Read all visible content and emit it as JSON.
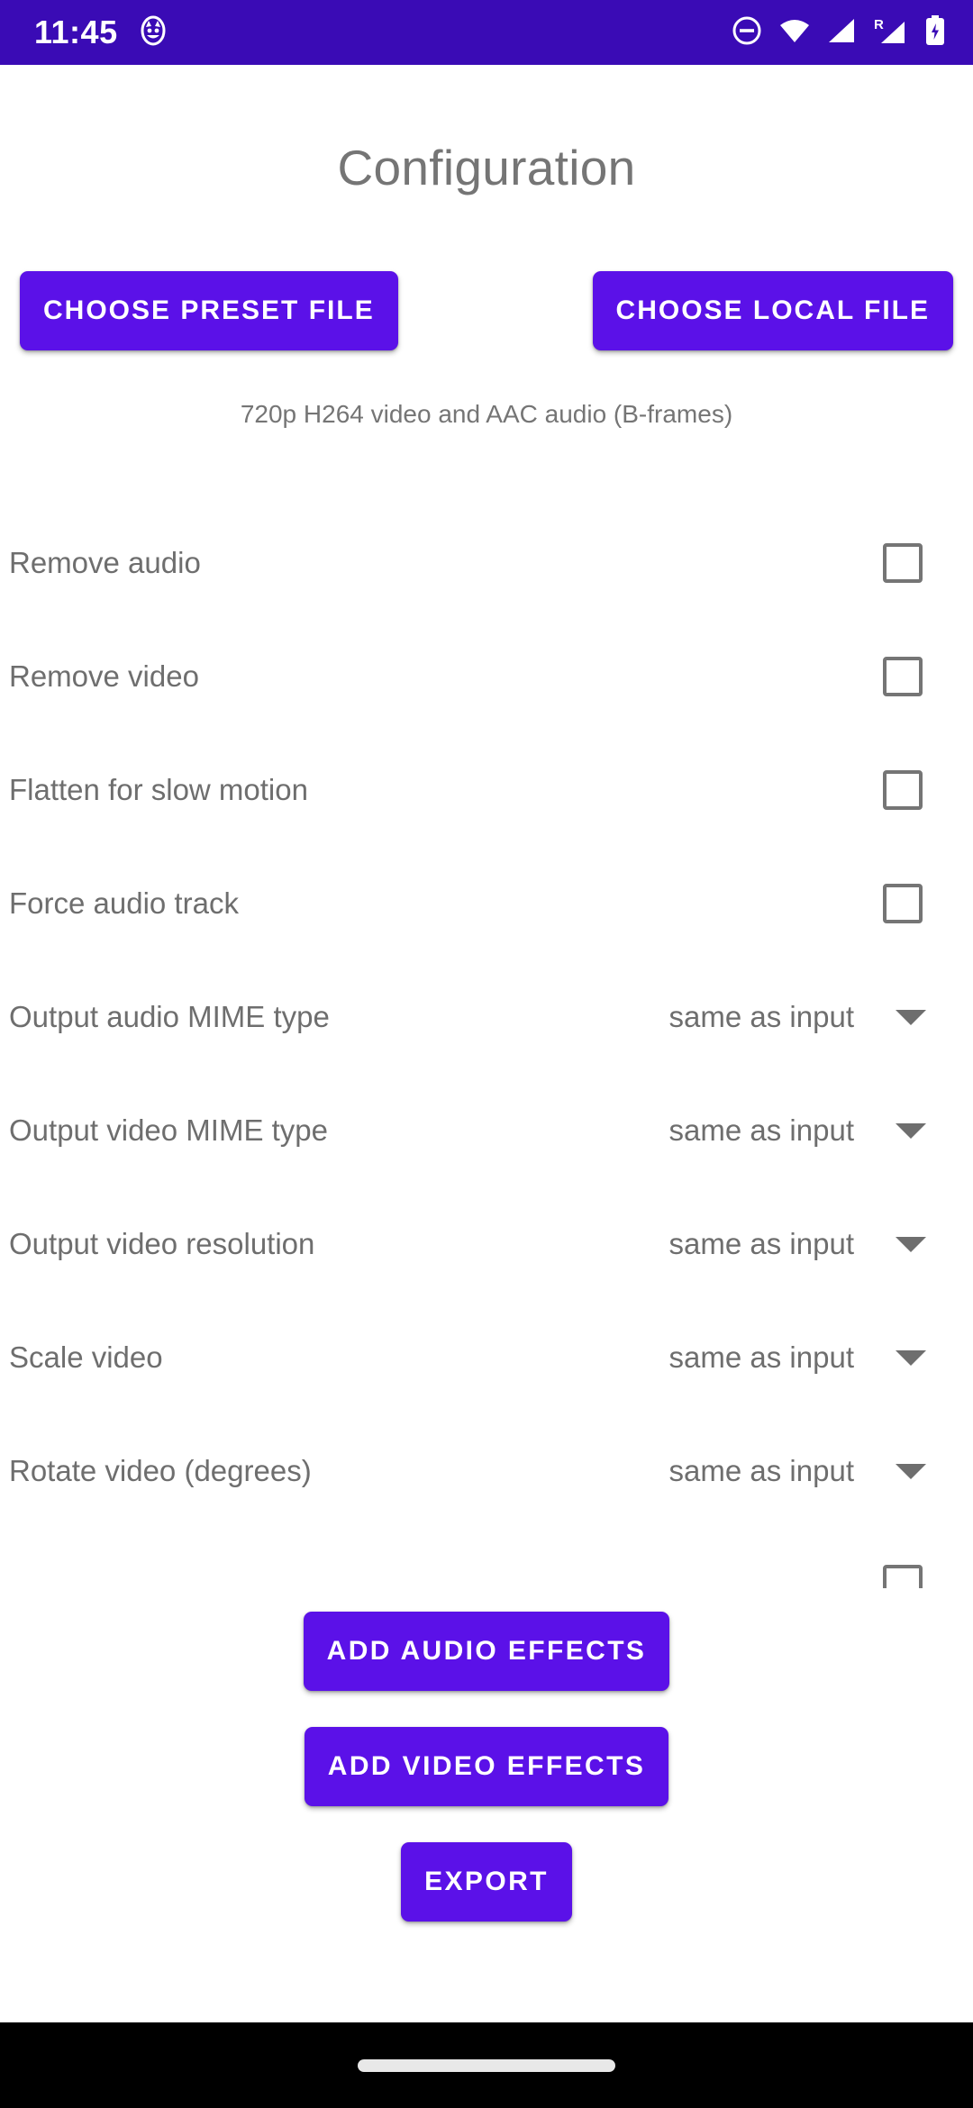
{
  "status_bar": {
    "time": "11:45",
    "background_color": "#3A0BB5",
    "icons": [
      {
        "name": "notification-cat-icon",
        "side": "left"
      },
      {
        "name": "do-not-disturb-icon",
        "side": "right"
      },
      {
        "name": "wifi-icon",
        "side": "right"
      },
      {
        "name": "cellular-signal-icon",
        "side": "right"
      },
      {
        "name": "cellular-roaming-signal-icon",
        "side": "right",
        "label": "R"
      },
      {
        "name": "battery-charging-icon",
        "side": "right"
      }
    ]
  },
  "header": {
    "title": "Configuration"
  },
  "file_selection": {
    "preset_button_label": "CHOOSE PRESET FILE",
    "local_button_label": "CHOOSE LOCAL FILE",
    "selected_file_description": "720p H264 video and AAC audio (B-frames)"
  },
  "options": [
    {
      "label": "Remove audio",
      "type": "checkbox",
      "checked": false
    },
    {
      "label": "Remove video",
      "type": "checkbox",
      "checked": false
    },
    {
      "label": "Flatten for slow motion",
      "type": "checkbox",
      "checked": false
    },
    {
      "label": "Force audio track",
      "type": "checkbox",
      "checked": false
    },
    {
      "label": "Output audio MIME type",
      "type": "spinner",
      "value": "same as input"
    },
    {
      "label": "Output video MIME type",
      "type": "spinner",
      "value": "same as input"
    },
    {
      "label": "Output video resolution",
      "type": "spinner",
      "value": "same as input"
    },
    {
      "label": "Scale video",
      "type": "spinner",
      "value": "same as input"
    },
    {
      "label": "Rotate video (degrees)",
      "type": "spinner",
      "value": "same as input"
    },
    {
      "label": "",
      "type": "checkbox",
      "checked": false,
      "partially_visible": true
    }
  ],
  "actions": {
    "add_audio_effects_label": "ADD AUDIO EFFECTS",
    "add_video_effects_label": "ADD VIDEO EFFECTS",
    "export_label": "EXPORT"
  },
  "theme": {
    "primary": "#5B11E8",
    "status_bar": "#3A0BB5",
    "text_secondary": "#6E6E6E",
    "title_color": "#757575",
    "nav_bar": "#000000",
    "nav_pill": "#E8E8E8"
  }
}
